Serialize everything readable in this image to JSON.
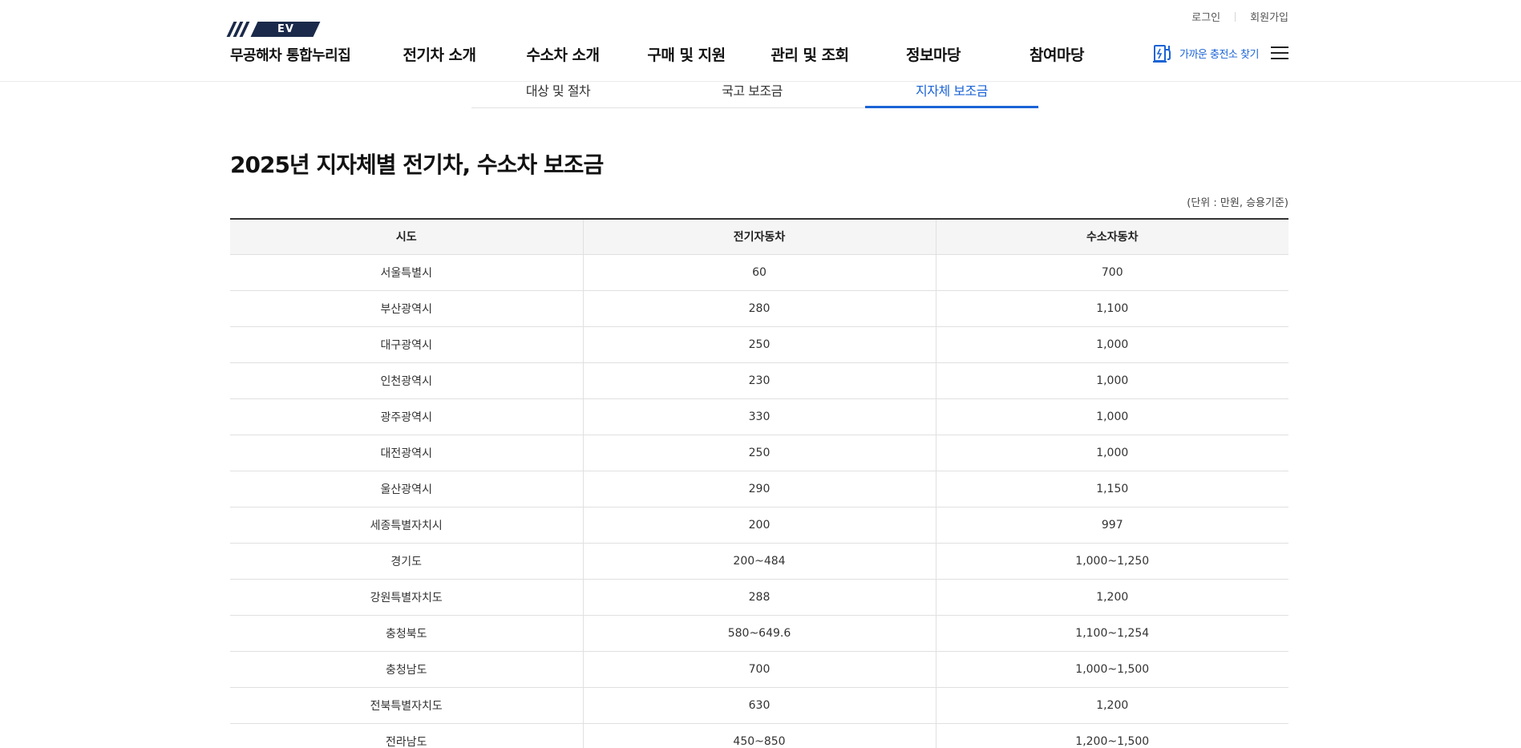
{
  "header": {
    "util": {
      "login": "로그인",
      "signup": "회원가입"
    },
    "logo": {
      "mark": "EV",
      "text": "무공해차 통합누리집"
    },
    "nav": [
      "전기차 소개",
      "수소차 소개",
      "구매 및 지원",
      "관리 및 조회",
      "정보마당",
      "참여마당"
    ],
    "charge_station": "가까운 충전소 찾기",
    "brand_color": "#1a63d6"
  },
  "tabs": [
    {
      "label": "대상 및 절차",
      "active": false
    },
    {
      "label": "국고 보조금",
      "active": false
    },
    {
      "label": "지자체 보조금",
      "active": true
    }
  ],
  "main": {
    "title": "2025년 지자체별 전기차, 수소차 보조금",
    "unit": "(단위 : 만원, 승용기준)",
    "table": {
      "headers": [
        "시도",
        "전기자동차",
        "수소자동차"
      ],
      "rows": [
        [
          "서울특별시",
          "60",
          "700"
        ],
        [
          "부산광역시",
          "280",
          "1,100"
        ],
        [
          "대구광역시",
          "250",
          "1,000"
        ],
        [
          "인천광역시",
          "230",
          "1,000"
        ],
        [
          "광주광역시",
          "330",
          "1,000"
        ],
        [
          "대전광역시",
          "250",
          "1,000"
        ],
        [
          "울산광역시",
          "290",
          "1,150"
        ],
        [
          "세종특별자치시",
          "200",
          "997"
        ],
        [
          "경기도",
          "200~484",
          "1,000~1,250"
        ],
        [
          "강원특별자치도",
          "288",
          "1,200"
        ],
        [
          "충청북도",
          "580~649.6",
          "1,100~1,254"
        ],
        [
          "충청남도",
          "700",
          "1,000~1,500"
        ],
        [
          "전북특별자치도",
          "630",
          "1,200"
        ],
        [
          "전라남도",
          "450~850",
          "1,200~1,500"
        ]
      ]
    }
  }
}
